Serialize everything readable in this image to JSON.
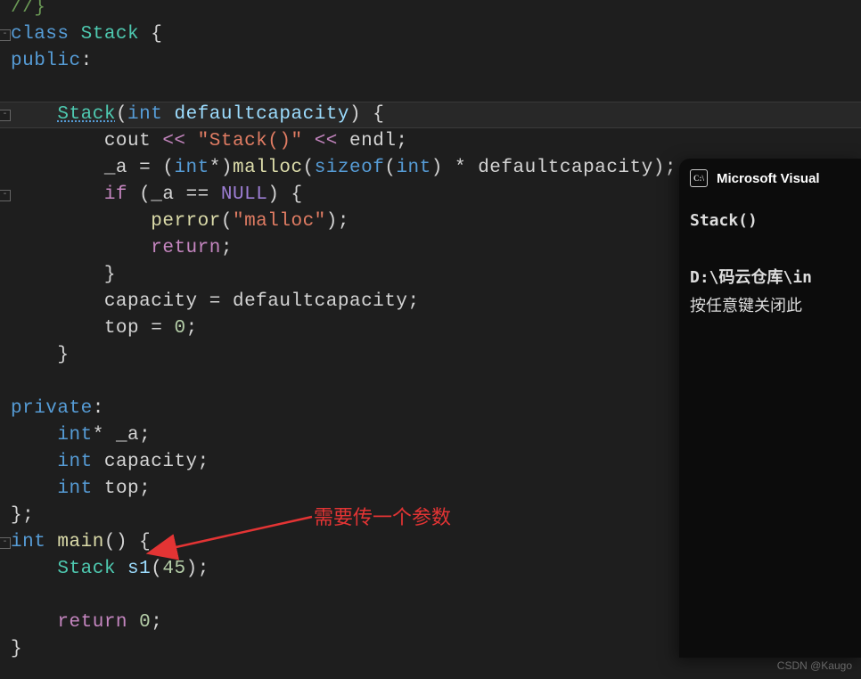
{
  "code": {
    "tokens": [
      [
        {
          "t": "//}",
          "c": "cmt"
        }
      ],
      [
        {
          "t": "class ",
          "c": "kw"
        },
        {
          "t": "Stack",
          "c": "cls"
        },
        {
          "t": " {",
          "c": "punc"
        }
      ],
      [
        {
          "t": "public",
          "c": "kw"
        },
        {
          "t": ":",
          "c": "punc"
        }
      ],
      [],
      [
        {
          "t": "    ",
          "c": "punc"
        },
        {
          "t": "Stack",
          "c": "cls underline"
        },
        {
          "t": "(",
          "c": "punc"
        },
        {
          "t": "int ",
          "c": "kw"
        },
        {
          "t": "defaultcapacity",
          "c": "var"
        },
        {
          "t": ") {",
          "c": "punc"
        }
      ],
      [
        {
          "t": "        cout ",
          "c": "punc"
        },
        {
          "t": "<<",
          "c": "op"
        },
        {
          "t": " ",
          "c": "punc"
        },
        {
          "t": "\"Stack()\"",
          "c": "str"
        },
        {
          "t": " ",
          "c": "punc"
        },
        {
          "t": "<<",
          "c": "op"
        },
        {
          "t": " endl;",
          "c": "punc"
        }
      ],
      [
        {
          "t": "        _a ",
          "c": "punc"
        },
        {
          "t": "=",
          "c": "punc"
        },
        {
          "t": " (",
          "c": "punc"
        },
        {
          "t": "int",
          "c": "kw"
        },
        {
          "t": "*",
          "c": "punc"
        },
        {
          "t": ")",
          "c": "punc"
        },
        {
          "t": "malloc",
          "c": "fn"
        },
        {
          "t": "(",
          "c": "punc"
        },
        {
          "t": "sizeof",
          "c": "kw"
        },
        {
          "t": "(",
          "c": "punc"
        },
        {
          "t": "int",
          "c": "kw"
        },
        {
          "t": ") ",
          "c": "punc"
        },
        {
          "t": "*",
          "c": "punc"
        },
        {
          "t": " defaultcapacity);",
          "c": "punc"
        }
      ],
      [
        {
          "t": "        ",
          "c": "punc"
        },
        {
          "t": "if",
          "c": "op"
        },
        {
          "t": " (_a ",
          "c": "punc"
        },
        {
          "t": "==",
          "c": "punc"
        },
        {
          "t": " ",
          "c": "punc"
        },
        {
          "t": "NULL",
          "c": "null"
        },
        {
          "t": ") {",
          "c": "punc"
        }
      ],
      [
        {
          "t": "            ",
          "c": "punc"
        },
        {
          "t": "perror",
          "c": "fn"
        },
        {
          "t": "(",
          "c": "punc"
        },
        {
          "t": "\"malloc\"",
          "c": "str"
        },
        {
          "t": ");",
          "c": "punc"
        }
      ],
      [
        {
          "t": "            ",
          "c": "punc"
        },
        {
          "t": "return",
          "c": "op"
        },
        {
          "t": ";",
          "c": "punc"
        }
      ],
      [
        {
          "t": "        }",
          "c": "punc"
        }
      ],
      [
        {
          "t": "        capacity ",
          "c": "punc"
        },
        {
          "t": "=",
          "c": "punc"
        },
        {
          "t": " defaultcapacity;",
          "c": "punc"
        }
      ],
      [
        {
          "t": "        top ",
          "c": "punc"
        },
        {
          "t": "=",
          "c": "punc"
        },
        {
          "t": " ",
          "c": "punc"
        },
        {
          "t": "0",
          "c": "num"
        },
        {
          "t": ";",
          "c": "punc"
        }
      ],
      [
        {
          "t": "    }",
          "c": "punc"
        }
      ],
      [],
      [
        {
          "t": "private",
          "c": "kw"
        },
        {
          "t": ":",
          "c": "punc"
        }
      ],
      [
        {
          "t": "    ",
          "c": "punc"
        },
        {
          "t": "int",
          "c": "kw"
        },
        {
          "t": "*",
          "c": "punc"
        },
        {
          "t": " _a;",
          "c": "punc"
        }
      ],
      [
        {
          "t": "    ",
          "c": "punc"
        },
        {
          "t": "int",
          "c": "kw"
        },
        {
          "t": " capacity;",
          "c": "punc"
        }
      ],
      [
        {
          "t": "    ",
          "c": "punc"
        },
        {
          "t": "int",
          "c": "kw"
        },
        {
          "t": " top;",
          "c": "punc"
        }
      ],
      [
        {
          "t": "};",
          "c": "punc"
        }
      ],
      [
        {
          "t": "int ",
          "c": "kw"
        },
        {
          "t": "main",
          "c": "fn"
        },
        {
          "t": "() {",
          "c": "punc"
        }
      ],
      [
        {
          "t": "    ",
          "c": "punc"
        },
        {
          "t": "Stack",
          "c": "cls"
        },
        {
          "t": " ",
          "c": "punc"
        },
        {
          "t": "s1",
          "c": "var"
        },
        {
          "t": "(",
          "c": "punc"
        },
        {
          "t": "45",
          "c": "num"
        },
        {
          "t": ");",
          "c": "punc"
        }
      ],
      [],
      [
        {
          "t": "    ",
          "c": "punc"
        },
        {
          "t": "return",
          "c": "op"
        },
        {
          "t": " ",
          "c": "punc"
        },
        {
          "t": "0",
          "c": "num"
        },
        {
          "t": ";",
          "c": "punc"
        }
      ],
      [
        {
          "t": "}",
          "c": "punc"
        }
      ]
    ],
    "highlight_line_index": 4,
    "fold_lines": [
      1,
      4,
      7,
      20
    ]
  },
  "console": {
    "title": "Microsoft Visual ",
    "lines": [
      {
        "t": "Stack()",
        "bold": true
      },
      {
        "t": ""
      },
      {
        "t": "D:\\码云仓库\\in",
        "bold": true
      },
      {
        "t": "按任意键关闭此"
      }
    ]
  },
  "annotation": {
    "text": "需要传一个参数"
  },
  "watermark": "CSDN @Kaugo"
}
